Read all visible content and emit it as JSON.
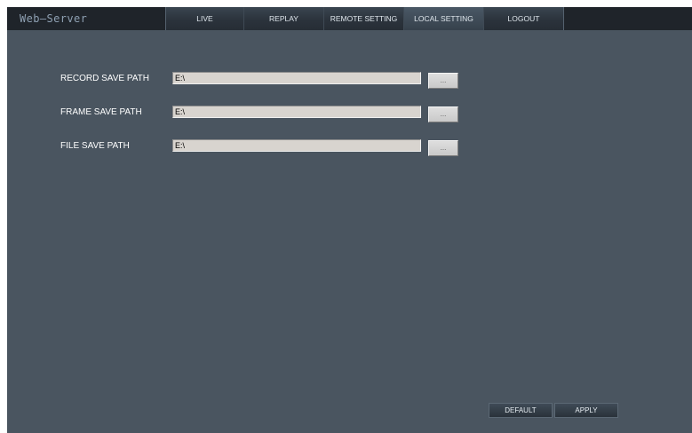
{
  "app": {
    "logo_text": "Web—Server"
  },
  "nav": {
    "tabs": [
      {
        "label": "LIVE"
      },
      {
        "label": "REPLAY"
      },
      {
        "label": "REMOTE SETTING"
      },
      {
        "label": "LOCAL SETTING"
      },
      {
        "label": "LOGOUT"
      }
    ],
    "active_tab": "LOCAL SETTING"
  },
  "form": {
    "rows": [
      {
        "label": "RECORD SAVE PATH",
        "value": "E:\\",
        "browse_label": "..."
      },
      {
        "label": "FRAME SAVE PATH",
        "value": "E:\\",
        "browse_label": "..."
      },
      {
        "label": "FILE SAVE PATH",
        "value": "E:\\",
        "browse_label": "..."
      }
    ]
  },
  "actions": {
    "default_label": "DEFAULT",
    "apply_label": "APPLY"
  },
  "colors": {
    "background": "#4a5560",
    "topbar": "#1f242a",
    "input_bg": "#d8d4cf"
  }
}
